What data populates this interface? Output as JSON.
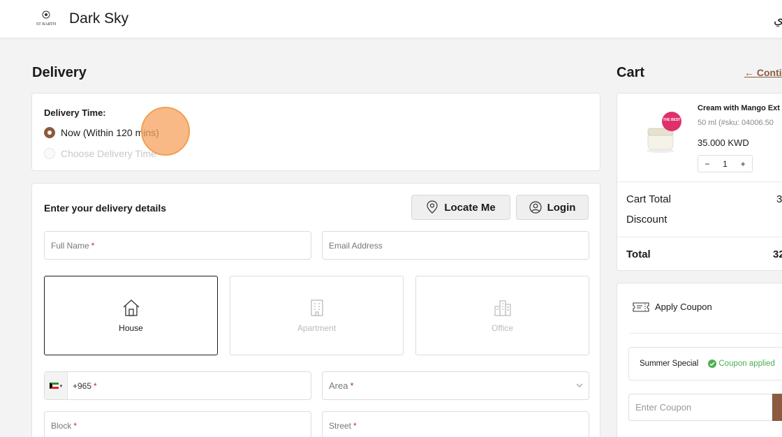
{
  "header": {
    "logo_text": "ST BARTH",
    "brand": "Dark Sky",
    "language_toggle": "ي"
  },
  "delivery": {
    "title": "Delivery",
    "time_label": "Delivery Time:",
    "options": [
      "Now (Within 120 mins)",
      "Choose Delivery Time"
    ],
    "selected_option": "Now (Within 120 mins)"
  },
  "details": {
    "title": "Enter your delivery details",
    "locate_label": "Locate Me",
    "login_label": "Login",
    "full_name_placeholder": "Full Name",
    "email_placeholder": "Email Address",
    "types": [
      "House",
      "Apartment",
      "Office"
    ],
    "selected_type": "House",
    "phone_prefix": "+965",
    "area_placeholder": "Area",
    "block_placeholder": "Block",
    "street_placeholder": "Street",
    "required_mark": "*"
  },
  "cart": {
    "title": "Cart",
    "continue_label": "Conti",
    "item": {
      "name": "Cream with Mango Ext",
      "variant": "50 ml (#sku: 04006.50",
      "price": "35.000 KWD",
      "qty": "1",
      "minus": "−",
      "plus": "+"
    },
    "cart_total_label": "Cart Total",
    "cart_total_value": "3",
    "discount_label": "Discount",
    "total_label": "Total",
    "total_value": "32"
  },
  "coupon": {
    "apply_label": "Apply Coupon",
    "coupon_name": "Summer Special",
    "coupon_status": "Coupon applied",
    "input_placeholder": "Enter Coupon"
  },
  "colors": {
    "accent": "#8c5a3f",
    "success": "#4caf50",
    "required": "#c62828"
  }
}
